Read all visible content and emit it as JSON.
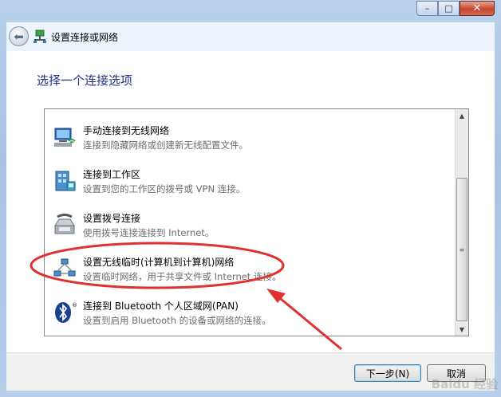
{
  "window": {
    "title": "设置连接或网络",
    "caption_buttons": {
      "minimize": "–",
      "maximize": "□",
      "close": "✕"
    }
  },
  "nav": {
    "back_icon": "back-arrow-icon",
    "app_icon": "network-icon"
  },
  "main": {
    "heading": "选择一个连接选项"
  },
  "options": [
    {
      "title": "手动连接到无线网络",
      "description": "连接到隐藏网络或创建新无线配置文件。",
      "icon": "wireless-network-icon"
    },
    {
      "title": "连接到工作区",
      "description": "设置到您的工作区的拨号或 VPN 连接。",
      "icon": "workplace-icon"
    },
    {
      "title": "设置拨号连接",
      "description": "使用拨号连接连接到 Internet。",
      "icon": "dialup-modem-icon"
    },
    {
      "title": "设置无线临时(计算机到计算机)网络",
      "description": "设置临时网络，用于共享文件或 Internet 连接。",
      "icon": "adhoc-network-icon"
    },
    {
      "title": "连接到 Bluetooth 个人区域网(PAN)",
      "description": "设置到启用 Bluetooth 的设备或网络的连接。",
      "icon": "bluetooth-icon"
    }
  ],
  "footer": {
    "next_label": "下一步(N)",
    "cancel_label": "取消"
  },
  "watermark": "Baidu 经验",
  "colors": {
    "heading": "#1e3287",
    "annotation": "#e03030",
    "description": "#6d6d6d"
  }
}
